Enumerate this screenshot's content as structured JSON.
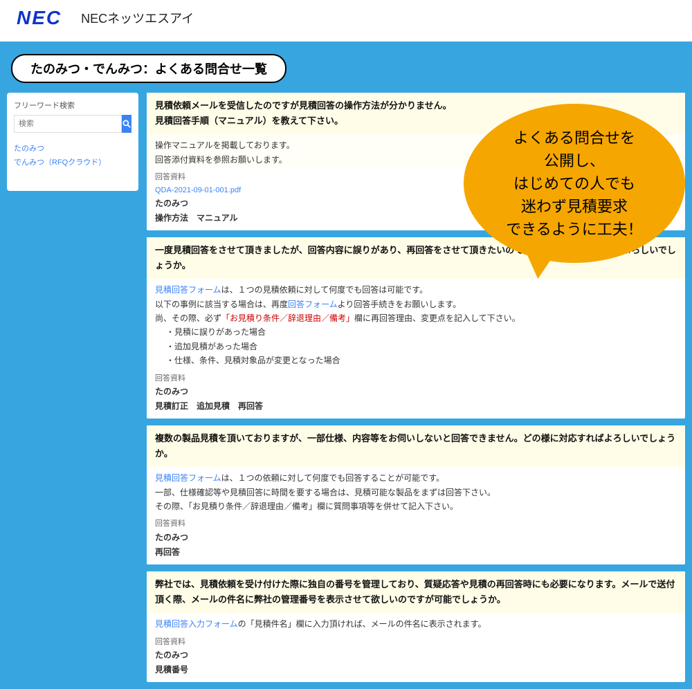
{
  "header": {
    "logo": "NEC",
    "brand": "NECネッツエスアイ"
  },
  "page_title": "たのみつ・でんみつ：よくある問合せ一覧",
  "sidebar": {
    "heading": "フリーワード検索",
    "search_placeholder": "検索",
    "links": [
      "たのみつ",
      "でんみつ（RFQクラウド）"
    ]
  },
  "bubble": "よくある問合せを\n公開し、\nはじめての人でも\n迷わず見積要求\nできるように工夫！",
  "faq": [
    {
      "q": "見積依頼メールを受信したのですが見積回答の操作方法が分かりません。\n見積回答手順（マニュアル）を教えて下さい。",
      "a_html": "操作マニュアルを掲載しております。<br>回答添付資料を参照お願いします。",
      "att_label": "回答資料",
      "att_file": "QDA-2021-09-01-001.pdf",
      "tag1": "たのみつ",
      "tag2": "操作方法　マニュアル"
    },
    {
      "q": "一度見積回答をさせて頂きましたが、回答内容に誤りがあり、再回答をさせて頂きたいのですがどの様に処理すればよろしいでしょうか。",
      "a_html": "<span class='linkish'>見積回答フォーム</span>は、１つの見積依頼に対して何度でも回答は可能です。<br>以下の事例に該当する場合は、再度<span class='linkish'>回答フォーム</span>より回答手続きをお願いします。<br>尚、その際、必ず<span class='red'>「お見積り条件／辞退理由／備考」</span>欄に再回答理由、変更点を記入して下さい。<div class='indent'>・見積に誤りがあった場合<br>・追加見積があった場合<br>・仕様、条件、見積対象品が変更となった場合</div>",
      "att_label": "回答資料",
      "tag1": "たのみつ",
      "tag2": "見積訂正　追加見積　再回答"
    },
    {
      "q": "複数の製品見積を頂いておりますが、一部仕様、内容等をお伺いしないと回答できません。どの様に対応すればよろしいでしょうか。",
      "a_html": "<span class='linkish'>見積回答フォーム</span>は、１つの依頼に対して何度でも回答することが可能です。<br>一部、仕様確認等や見積回答に時間を要する場合は、見積可能な製品をまずは回答下さい。<br>その際、「お見積り条件／辞退理由／備考」欄に質問事項等を併せて記入下さい。",
      "att_label": "回答資料",
      "tag1": "たのみつ",
      "tag2": "再回答"
    },
    {
      "q": "弊社では、見積依頼を受け付けた際に独自の番号を管理しており、質疑応答や見積の再回答時にも必要になります。メールで送付頂く際、メールの件名に弊社の管理番号を表示させて欲しいのですが可能でしょうか。",
      "a_html": "<span class='linkish'>見積回答入力フォーム</span>の「見積件名」欄に入力頂ければ、メールの件名に表示されます。",
      "att_label": "回答資料",
      "tag1": "たのみつ",
      "tag2": "見積番号"
    }
  ]
}
